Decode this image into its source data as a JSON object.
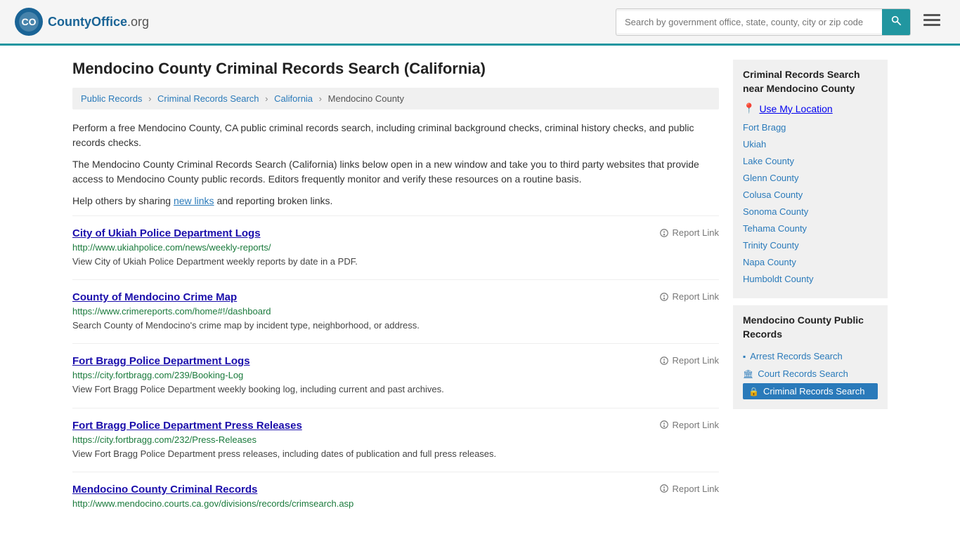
{
  "header": {
    "logo_text": "CountyOffice",
    "logo_suffix": ".org",
    "search_placeholder": "Search by government office, state, county, city or zip code",
    "search_value": ""
  },
  "page": {
    "title": "Mendocino County Criminal Records Search (California)",
    "breadcrumb": [
      "Public Records",
      "Criminal Records Search",
      "California",
      "Mendocino County"
    ]
  },
  "description": {
    "para1": "Perform a free Mendocino County, CA public criminal records search, including criminal background checks, criminal history checks, and public records checks.",
    "para2": "The Mendocino County Criminal Records Search (California) links below open in a new window and take you to third party websites that provide access to Mendocino County public records. Editors frequently monitor and verify these resources on a routine basis.",
    "para3_before": "Help others by sharing ",
    "para3_link": "new links",
    "para3_after": " and reporting broken links."
  },
  "results": [
    {
      "title": "City of Ukiah Police Department Logs",
      "url": "http://www.ukiahpolice.com/news/weekly-reports/",
      "description": "View City of Ukiah Police Department weekly reports by date in a PDF.",
      "report_label": "Report Link"
    },
    {
      "title": "County of Mendocino Crime Map",
      "url": "https://www.crimereports.com/home#!/dashboard",
      "description": "Search County of Mendocino's crime map by incident type, neighborhood, or address.",
      "report_label": "Report Link"
    },
    {
      "title": "Fort Bragg Police Department Logs",
      "url": "https://city.fortbragg.com/239/Booking-Log",
      "description": "View Fort Bragg Police Department weekly booking log, including current and past archives.",
      "report_label": "Report Link"
    },
    {
      "title": "Fort Bragg Police Department Press Releases",
      "url": "https://city.fortbragg.com/232/Press-Releases",
      "description": "View Fort Bragg Police Department press releases, including dates of publication and full press releases.",
      "report_label": "Report Link"
    },
    {
      "title": "Mendocino County Criminal Records",
      "url": "http://www.mendocino.courts.ca.gov/divisions/records/crimsearch.asp",
      "description": "",
      "report_label": "Report Link"
    }
  ],
  "sidebar": {
    "nearby_title": "Criminal Records Search near Mendocino County",
    "use_location_label": "Use My Location",
    "nearby_links": [
      "Fort Bragg",
      "Ukiah",
      "Lake County",
      "Glenn County",
      "Colusa County",
      "Sonoma County",
      "Tehama County",
      "Trinity County",
      "Napa County",
      "Humboldt County"
    ],
    "public_records_title": "Mendocino County Public Records",
    "public_records_links": [
      {
        "label": "Arrest Records Search",
        "icon": "▪",
        "active": false
      },
      {
        "label": "Court Records Search",
        "icon": "🏛",
        "active": false
      },
      {
        "label": "Criminal Records Search",
        "icon": "🔒",
        "active": true
      }
    ]
  }
}
